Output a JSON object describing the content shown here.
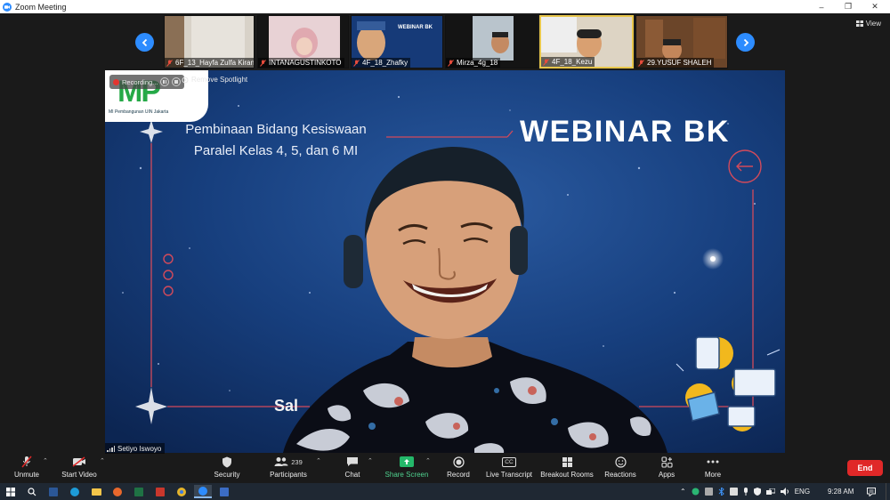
{
  "window": {
    "title": "Zoom Meeting",
    "controls": {
      "minimize": "–",
      "restore": "❐",
      "close": "✕"
    }
  },
  "gallery": {
    "prev_icon": "chevron-left-icon",
    "next_icon": "chevron-right-icon",
    "view_label": "View",
    "participants": [
      {
        "name": "6F_13_Hayfa Zulfa Kirani",
        "muted": true
      },
      {
        "name": "INTANAGUSTINKOTO",
        "muted": true
      },
      {
        "name": "4F_18_Zhafky",
        "muted": true
      },
      {
        "name": "Mirza_4g_18",
        "muted": true
      },
      {
        "name": "4F_18_Kezu",
        "muted": true
      },
      {
        "name": "29.YUSUF SHALEH",
        "muted": true
      }
    ]
  },
  "main": {
    "recording_label": "Recording...",
    "remove_spotlight_label": "Remove Spotlight",
    "speaker_name": "Setiyo Iswoyo",
    "slide": {
      "logo_text": "MP",
      "logo_subtext": "MI Pembangunan UIN Jakarta",
      "subtitle_line1": "Pembinaan Bidang Kesiswaan",
      "subtitle_line2": "Paralel Kelas 4, 5, dan 6 MI",
      "title": "WEBINAR BK",
      "partial_text": "Sal"
    }
  },
  "toolbar": {
    "unmute": "Unmute",
    "start_video": "Start Video",
    "security": "Security",
    "participants": "Participants",
    "participant_count": "239",
    "chat": "Chat",
    "share_screen": "Share Screen",
    "record": "Record",
    "live_transcript": "Live Transcript",
    "live_transcript_badge": "CC",
    "breakout_rooms": "Breakout Rooms",
    "reactions": "Reactions",
    "apps": "Apps",
    "more": "More",
    "end": "End"
  },
  "taskbar": {
    "language": "ENG",
    "time": "9:28 AM"
  },
  "colors": {
    "zoom_blue": "#2d8cff",
    "end_red": "#e02828",
    "share_green": "#24b86a",
    "toolbar_bg": "#1a1a1a",
    "slide_bg": "#123a73",
    "logo_green": "#25a947"
  }
}
